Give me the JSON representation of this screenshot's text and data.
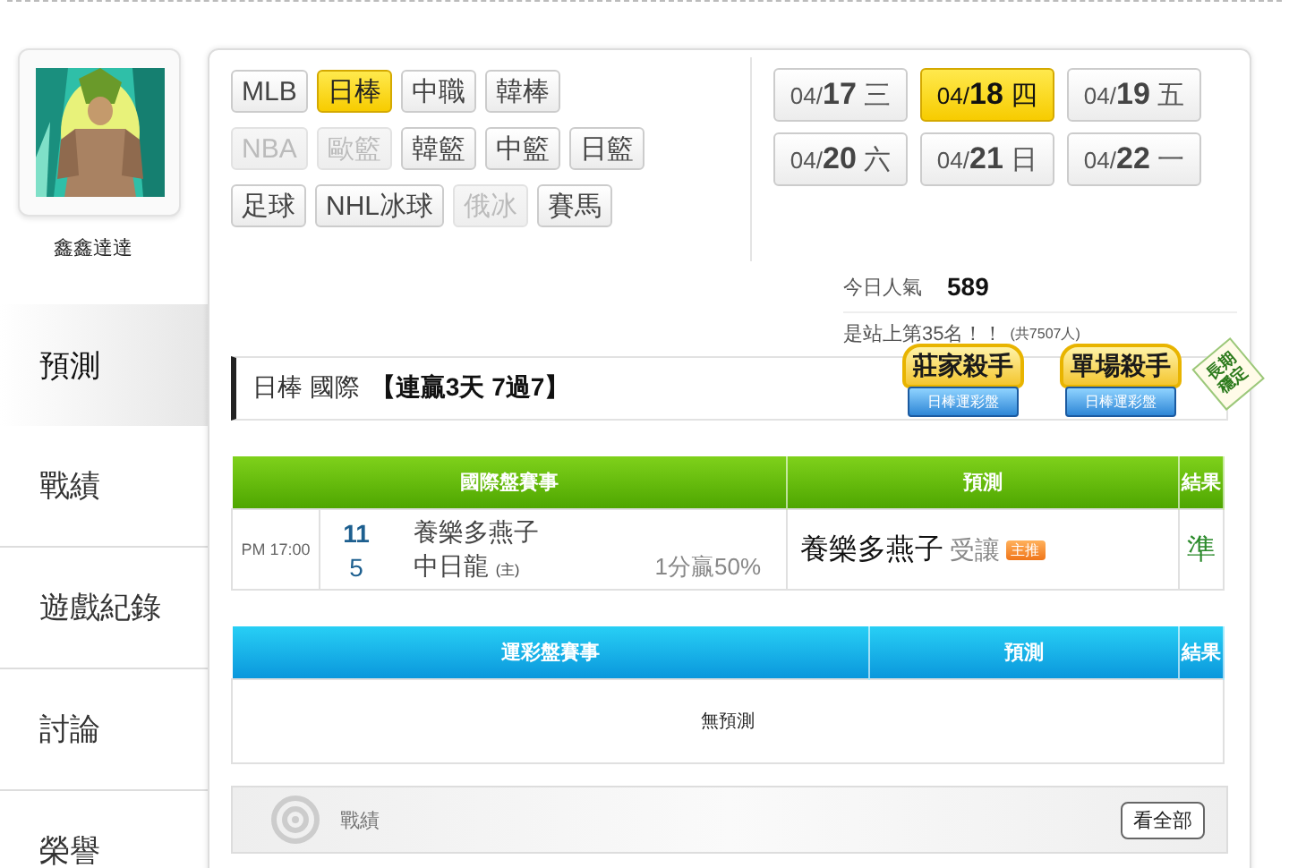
{
  "user": {
    "name": "鑫鑫達達"
  },
  "nav": [
    {
      "label": "預測",
      "selected": true
    },
    {
      "label": "戰績",
      "selected": false
    },
    {
      "label": "遊戲紀錄",
      "selected": false
    },
    {
      "label": "討論",
      "selected": false
    },
    {
      "label": "榮譽",
      "selected": false
    }
  ],
  "leagues": [
    [
      {
        "label": "MLB",
        "selected": false,
        "disabled": false
      },
      {
        "label": "日棒",
        "selected": true,
        "disabled": false
      },
      {
        "label": "中職",
        "selected": false,
        "disabled": false
      },
      {
        "label": "韓棒",
        "selected": false,
        "disabled": false
      }
    ],
    [
      {
        "label": "NBA",
        "selected": false,
        "disabled": true
      },
      {
        "label": "歐籃",
        "selected": false,
        "disabled": true
      },
      {
        "label": "韓籃",
        "selected": false,
        "disabled": false
      },
      {
        "label": "中籃",
        "selected": false,
        "disabled": false
      },
      {
        "label": "日籃",
        "selected": false,
        "disabled": false
      }
    ],
    [
      {
        "label": "足球",
        "selected": false,
        "disabled": false
      },
      {
        "label": "NHL冰球",
        "selected": false,
        "disabled": false
      },
      {
        "label": "俄冰",
        "selected": false,
        "disabled": true
      },
      {
        "label": "賽馬",
        "selected": false,
        "disabled": false
      }
    ]
  ],
  "dates": [
    {
      "prefix": "04/",
      "day": "17",
      "weekday": "三",
      "selected": false
    },
    {
      "prefix": "04/",
      "day": "18",
      "weekday": "四",
      "selected": true
    },
    {
      "prefix": "04/",
      "day": "19",
      "weekday": "五",
      "selected": false
    },
    {
      "prefix": "04/",
      "day": "20",
      "weekday": "六",
      "selected": false
    },
    {
      "prefix": "04/",
      "day": "21",
      "weekday": "日",
      "selected": false
    },
    {
      "prefix": "04/",
      "day": "22",
      "weekday": "一",
      "selected": false
    }
  ],
  "stats": {
    "popularity_label": "今日人氣",
    "popularity": "589",
    "rank": "是站上第35名！！",
    "total": "(共7507人)"
  },
  "title": {
    "league": "日棒 國際",
    "streak": "【連贏3天 7過7】"
  },
  "badges": [
    {
      "title": "莊家殺手",
      "subtitle": "日棒運彩盤"
    },
    {
      "title": "單場殺手",
      "subtitle": "日棒運彩盤"
    }
  ],
  "ribbon": "長期穩定",
  "intl_table": {
    "columns": [
      "國際盤賽事",
      "預測",
      "結果"
    ],
    "rows": [
      {
        "time": "PM 17:00",
        "away_score": "11",
        "home_score": "5",
        "away_team": "養樂多燕子",
        "home_team": "中日龍",
        "home_mark": "(主)",
        "line": "1分贏50%",
        "pick": "養樂多燕子",
        "pick_type": "受讓",
        "pick_tag": "主推",
        "result": "準"
      }
    ]
  },
  "lottery_table": {
    "columns": [
      "運彩盤賽事",
      "預測",
      "結果"
    ],
    "empty_text": "無預測"
  },
  "record_panel": {
    "title": "戰績",
    "button": "看全部"
  }
}
